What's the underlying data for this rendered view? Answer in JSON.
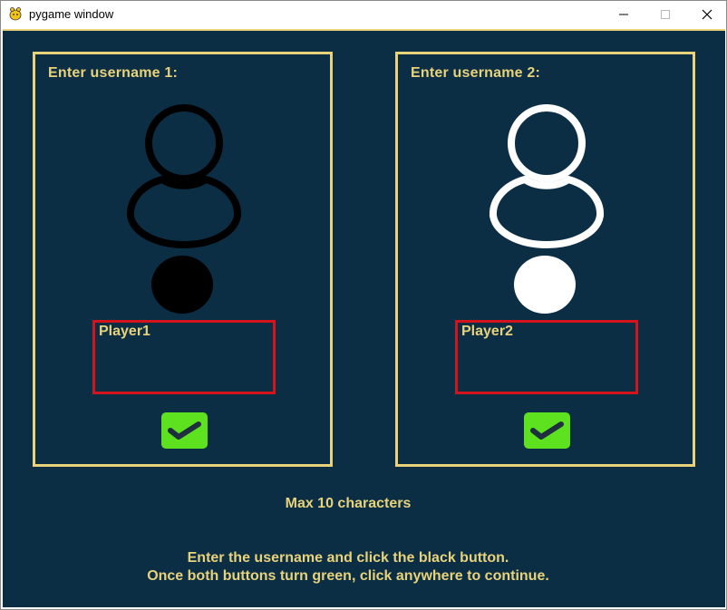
{
  "window": {
    "title": "pygame window"
  },
  "panels": [
    {
      "title": "Enter username 1:",
      "username": "Player1",
      "avatar_color": "#000000",
      "dot_color": "#000000"
    },
    {
      "title": "Enter username 2:",
      "username": "Player2",
      "avatar_color": "#ffffff",
      "dot_color": "#ffffff"
    }
  ],
  "footer": {
    "max_chars": "Max 10 characters",
    "instruction_line1": "Enter the username and click the black button.",
    "instruction_line2": "Once both buttons turn green, click anywhere to continue."
  },
  "colors": {
    "background": "#0b2e45",
    "accent": "#e8d27a",
    "input_border": "#d4141c",
    "button_green": "#5ee11e"
  },
  "icons": {
    "app": "pygame-icon",
    "minimize": "minimize-icon",
    "maximize": "maximize-icon",
    "close": "close-icon",
    "avatar": "user-icon",
    "confirm": "checkmark-icon"
  }
}
